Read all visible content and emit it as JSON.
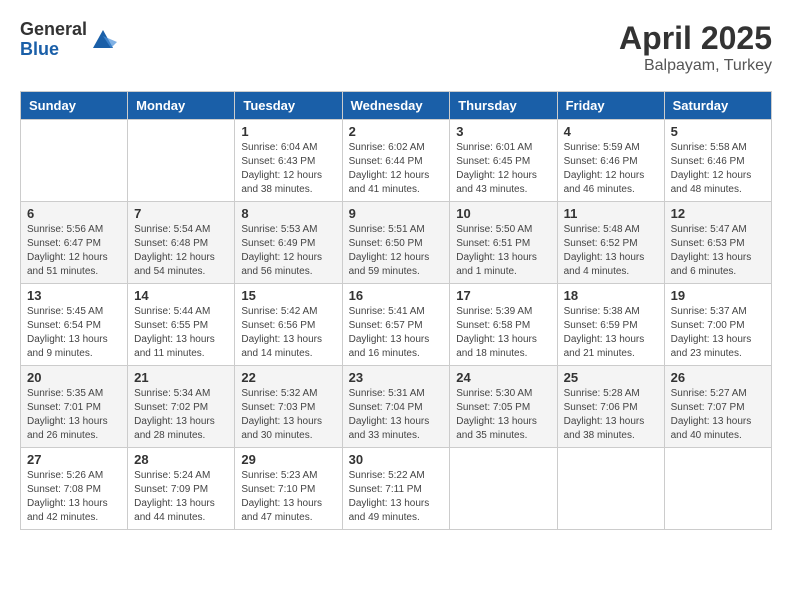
{
  "header": {
    "logo_general": "General",
    "logo_blue": "Blue",
    "month_title": "April 2025",
    "location": "Balpayam, Turkey"
  },
  "weekdays": [
    "Sunday",
    "Monday",
    "Tuesday",
    "Wednesday",
    "Thursday",
    "Friday",
    "Saturday"
  ],
  "weeks": [
    [
      {
        "day": "",
        "info": ""
      },
      {
        "day": "",
        "info": ""
      },
      {
        "day": "1",
        "info": "Sunrise: 6:04 AM\nSunset: 6:43 PM\nDaylight: 12 hours and 38 minutes."
      },
      {
        "day": "2",
        "info": "Sunrise: 6:02 AM\nSunset: 6:44 PM\nDaylight: 12 hours and 41 minutes."
      },
      {
        "day": "3",
        "info": "Sunrise: 6:01 AM\nSunset: 6:45 PM\nDaylight: 12 hours and 43 minutes."
      },
      {
        "day": "4",
        "info": "Sunrise: 5:59 AM\nSunset: 6:46 PM\nDaylight: 12 hours and 46 minutes."
      },
      {
        "day": "5",
        "info": "Sunrise: 5:58 AM\nSunset: 6:46 PM\nDaylight: 12 hours and 48 minutes."
      }
    ],
    [
      {
        "day": "6",
        "info": "Sunrise: 5:56 AM\nSunset: 6:47 PM\nDaylight: 12 hours and 51 minutes."
      },
      {
        "day": "7",
        "info": "Sunrise: 5:54 AM\nSunset: 6:48 PM\nDaylight: 12 hours and 54 minutes."
      },
      {
        "day": "8",
        "info": "Sunrise: 5:53 AM\nSunset: 6:49 PM\nDaylight: 12 hours and 56 minutes."
      },
      {
        "day": "9",
        "info": "Sunrise: 5:51 AM\nSunset: 6:50 PM\nDaylight: 12 hours and 59 minutes."
      },
      {
        "day": "10",
        "info": "Sunrise: 5:50 AM\nSunset: 6:51 PM\nDaylight: 13 hours and 1 minute."
      },
      {
        "day": "11",
        "info": "Sunrise: 5:48 AM\nSunset: 6:52 PM\nDaylight: 13 hours and 4 minutes."
      },
      {
        "day": "12",
        "info": "Sunrise: 5:47 AM\nSunset: 6:53 PM\nDaylight: 13 hours and 6 minutes."
      }
    ],
    [
      {
        "day": "13",
        "info": "Sunrise: 5:45 AM\nSunset: 6:54 PM\nDaylight: 13 hours and 9 minutes."
      },
      {
        "day": "14",
        "info": "Sunrise: 5:44 AM\nSunset: 6:55 PM\nDaylight: 13 hours and 11 minutes."
      },
      {
        "day": "15",
        "info": "Sunrise: 5:42 AM\nSunset: 6:56 PM\nDaylight: 13 hours and 14 minutes."
      },
      {
        "day": "16",
        "info": "Sunrise: 5:41 AM\nSunset: 6:57 PM\nDaylight: 13 hours and 16 minutes."
      },
      {
        "day": "17",
        "info": "Sunrise: 5:39 AM\nSunset: 6:58 PM\nDaylight: 13 hours and 18 minutes."
      },
      {
        "day": "18",
        "info": "Sunrise: 5:38 AM\nSunset: 6:59 PM\nDaylight: 13 hours and 21 minutes."
      },
      {
        "day": "19",
        "info": "Sunrise: 5:37 AM\nSunset: 7:00 PM\nDaylight: 13 hours and 23 minutes."
      }
    ],
    [
      {
        "day": "20",
        "info": "Sunrise: 5:35 AM\nSunset: 7:01 PM\nDaylight: 13 hours and 26 minutes."
      },
      {
        "day": "21",
        "info": "Sunrise: 5:34 AM\nSunset: 7:02 PM\nDaylight: 13 hours and 28 minutes."
      },
      {
        "day": "22",
        "info": "Sunrise: 5:32 AM\nSunset: 7:03 PM\nDaylight: 13 hours and 30 minutes."
      },
      {
        "day": "23",
        "info": "Sunrise: 5:31 AM\nSunset: 7:04 PM\nDaylight: 13 hours and 33 minutes."
      },
      {
        "day": "24",
        "info": "Sunrise: 5:30 AM\nSunset: 7:05 PM\nDaylight: 13 hours and 35 minutes."
      },
      {
        "day": "25",
        "info": "Sunrise: 5:28 AM\nSunset: 7:06 PM\nDaylight: 13 hours and 38 minutes."
      },
      {
        "day": "26",
        "info": "Sunrise: 5:27 AM\nSunset: 7:07 PM\nDaylight: 13 hours and 40 minutes."
      }
    ],
    [
      {
        "day": "27",
        "info": "Sunrise: 5:26 AM\nSunset: 7:08 PM\nDaylight: 13 hours and 42 minutes."
      },
      {
        "day": "28",
        "info": "Sunrise: 5:24 AM\nSunset: 7:09 PM\nDaylight: 13 hours and 44 minutes."
      },
      {
        "day": "29",
        "info": "Sunrise: 5:23 AM\nSunset: 7:10 PM\nDaylight: 13 hours and 47 minutes."
      },
      {
        "day": "30",
        "info": "Sunrise: 5:22 AM\nSunset: 7:11 PM\nDaylight: 13 hours and 49 minutes."
      },
      {
        "day": "",
        "info": ""
      },
      {
        "day": "",
        "info": ""
      },
      {
        "day": "",
        "info": ""
      }
    ]
  ]
}
